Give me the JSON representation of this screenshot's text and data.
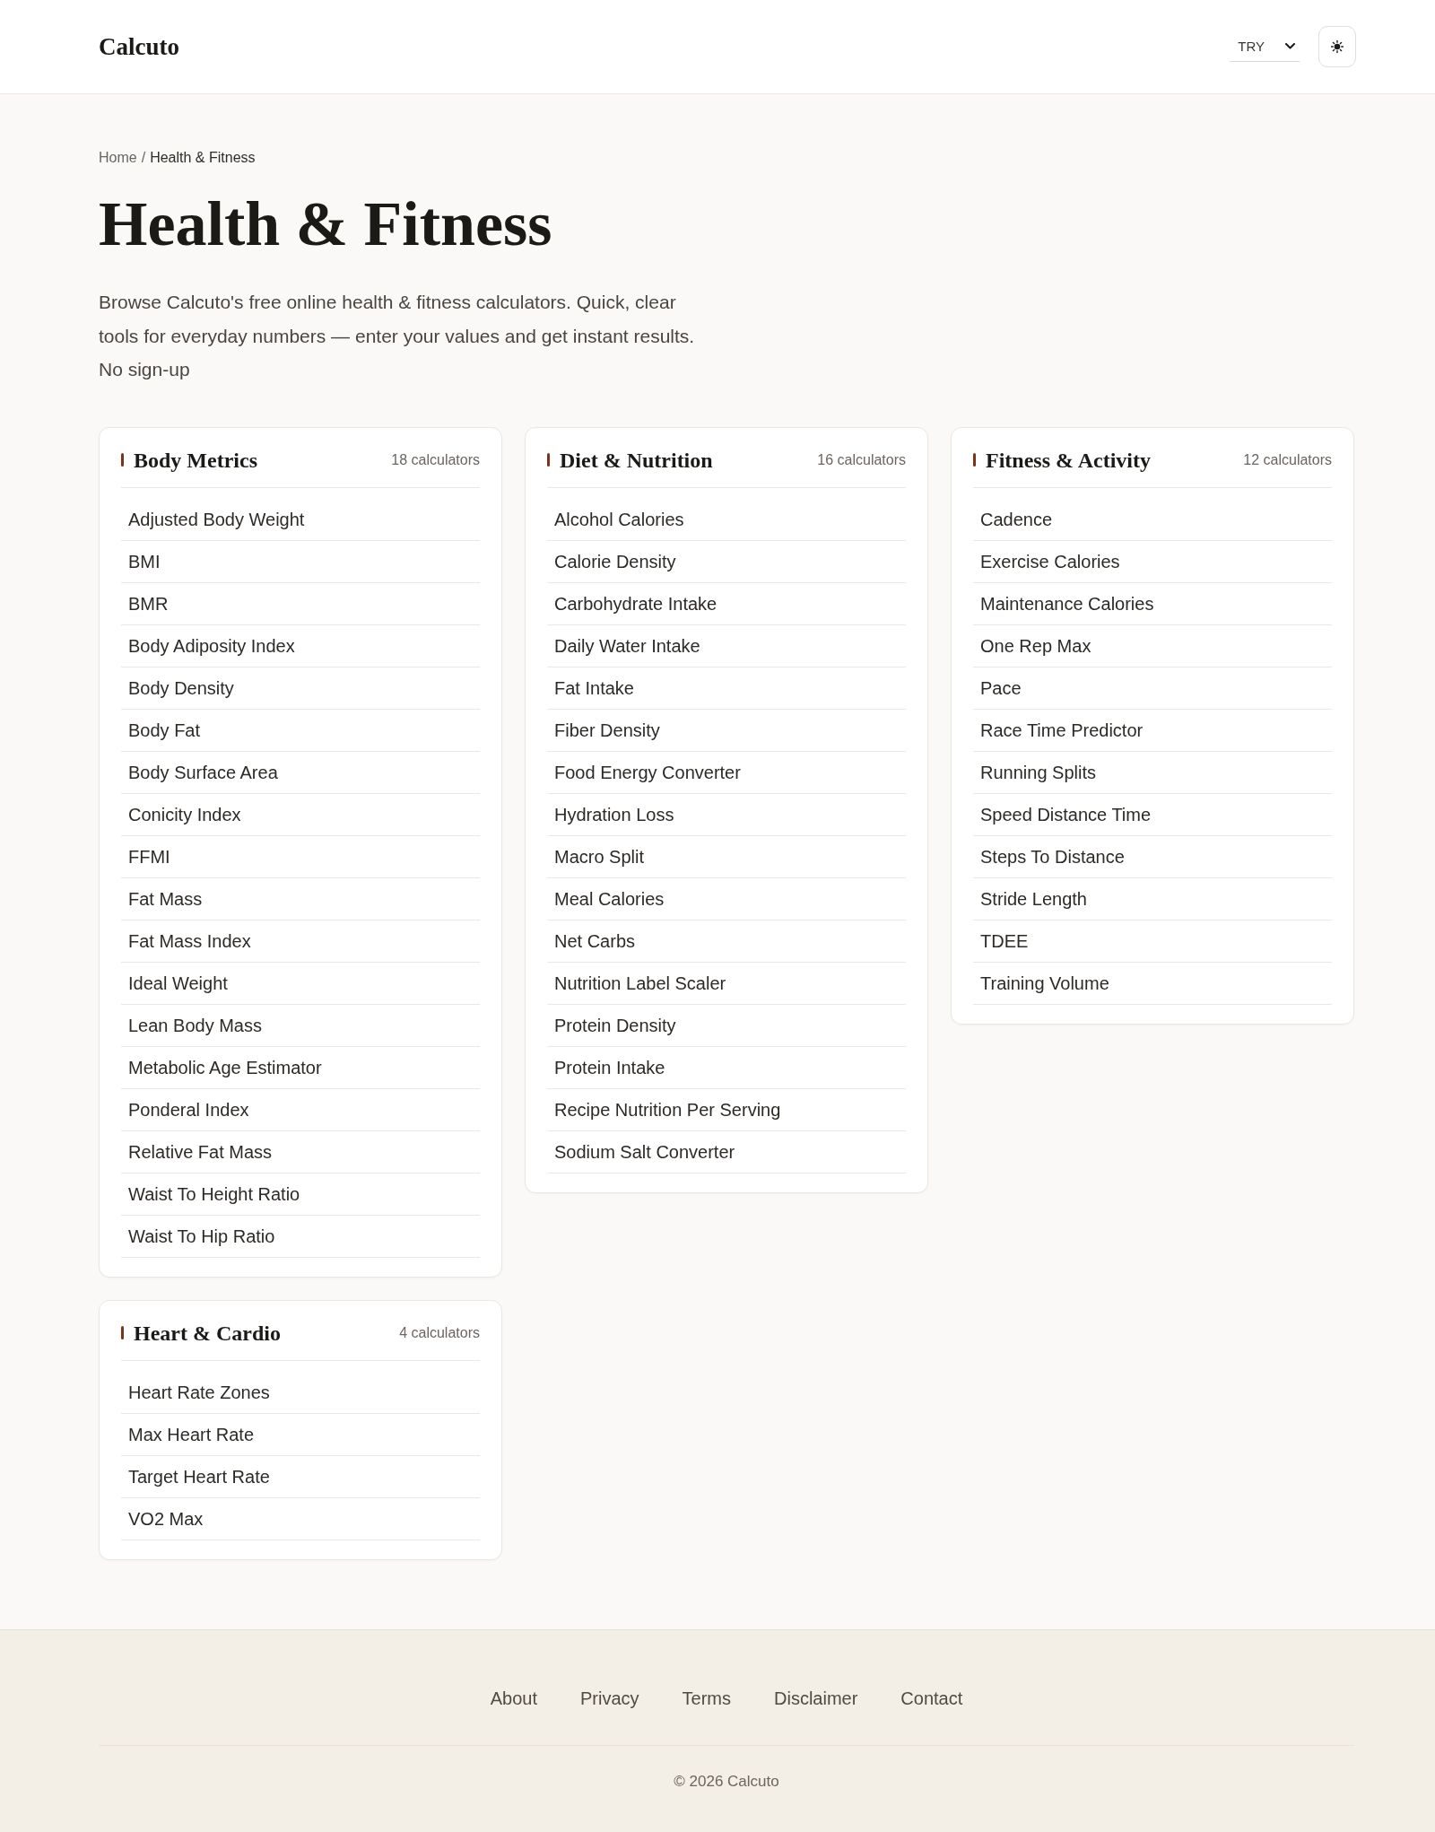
{
  "header": {
    "logo": "Calcuto",
    "currency_select": {
      "value": "TRY"
    }
  },
  "breadcrumb": {
    "separator": "/",
    "items": [
      {
        "label": "Home",
        "current": false
      },
      {
        "label": "Health & Fitness",
        "current": true
      }
    ]
  },
  "page_title": "Health & Fitness",
  "intro": "Browse Calcuto's free online health & fitness calculators. Quick, clear tools for everyday numbers — enter your values and get instant results. No sign-up",
  "categories": [
    {
      "title": "Body Metrics",
      "count": "18 calculators",
      "items": [
        "Adjusted Body Weight",
        "BMI",
        "BMR",
        "Body Adiposity Index",
        "Body Density",
        "Body Fat",
        "Body Surface Area",
        "Conicity Index",
        "FFMI",
        "Fat Mass",
        "Fat Mass Index",
        "Ideal Weight",
        "Lean Body Mass",
        "Metabolic Age Estimator",
        "Ponderal Index",
        "Relative Fat Mass",
        "Waist To Height Ratio",
        "Waist To Hip Ratio"
      ]
    },
    {
      "title": "Diet & Nutrition",
      "count": "16 calculators",
      "items": [
        "Alcohol Calories",
        "Calorie Density",
        "Carbohydrate Intake",
        "Daily Water Intake",
        "Fat Intake",
        "Fiber Density",
        "Food Energy Converter",
        "Hydration Loss",
        "Macro Split",
        "Meal Calories",
        "Net Carbs",
        "Nutrition Label Scaler",
        "Protein Density",
        "Protein Intake",
        "Recipe Nutrition Per Serving",
        "Sodium Salt Converter"
      ]
    },
    {
      "title": "Fitness & Activity",
      "count": "12 calculators",
      "items": [
        "Cadence",
        "Exercise Calories",
        "Maintenance Calories",
        "One Rep Max",
        "Pace",
        "Race Time Predictor",
        "Running Splits",
        "Speed Distance Time",
        "Steps To Distance",
        "Stride Length",
        "TDEE",
        "Training Volume"
      ]
    },
    {
      "title": "Heart & Cardio",
      "count": "4 calculators",
      "items": [
        "Heart Rate Zones",
        "Max Heart Rate",
        "Target Heart Rate",
        "VO2 Max"
      ]
    }
  ],
  "footer": {
    "links": [
      "About",
      "Privacy",
      "Terms",
      "Disclaimer",
      "Contact"
    ],
    "copyright": "© 2026 Calcuto"
  }
}
